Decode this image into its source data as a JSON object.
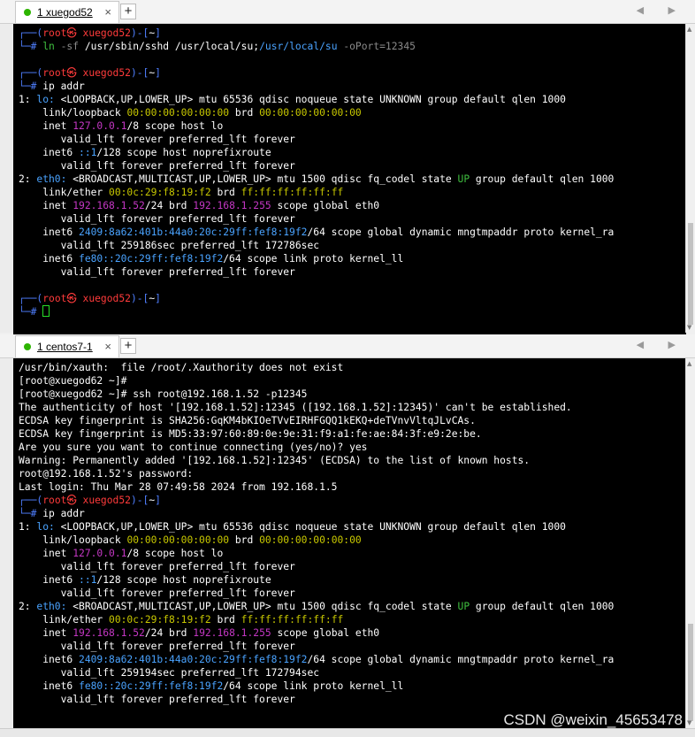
{
  "top": {
    "tab_label": "1 xuegod52",
    "close_glyph": "×",
    "plus_glyph": "+",
    "arrows": "◀ ▶",
    "lines": [
      [
        {
          "t": "┌──(",
          "c": "blue"
        },
        {
          "t": "root㉿ xuegod52",
          "c": "red"
        },
        {
          "t": ")-[",
          "c": "blue"
        },
        {
          "t": "~",
          "c": "white"
        },
        {
          "t": "]",
          "c": "blue"
        }
      ],
      [
        {
          "t": "└─# ",
          "c": "blue"
        },
        {
          "t": "ln",
          "c": "green"
        },
        {
          "t": " -sf ",
          "c": "dim"
        },
        {
          "t": "/usr/sbin/sshd /usr/local/su",
          "c": "white"
        },
        {
          "t": ";",
          "c": "white"
        },
        {
          "t": "/usr/local/su",
          "c": "cyan"
        },
        {
          "t": " -oPort=12345",
          "c": "dim"
        }
      ],
      [],
      [
        {
          "t": "┌──(",
          "c": "blue"
        },
        {
          "t": "root㉿ xuegod52",
          "c": "red"
        },
        {
          "t": ")-[",
          "c": "blue"
        },
        {
          "t": "~",
          "c": "white"
        },
        {
          "t": "]",
          "c": "blue"
        }
      ],
      [
        {
          "t": "└─# ",
          "c": "blue"
        },
        {
          "t": "ip addr",
          "c": "white"
        }
      ],
      [
        {
          "t": "1: ",
          "c": "white"
        },
        {
          "t": "lo:",
          "c": "cyan"
        },
        {
          "t": " <LOOPBACK,UP,LOWER_UP> mtu 65536 qdisc noqueue state UNKNOWN group default qlen 1000",
          "c": "white"
        }
      ],
      [
        {
          "t": "    link/loopback ",
          "c": "white"
        },
        {
          "t": "00:00:00:00:00:00",
          "c": "yellow"
        },
        {
          "t": " brd ",
          "c": "white"
        },
        {
          "t": "00:00:00:00:00:00",
          "c": "yellow"
        }
      ],
      [
        {
          "t": "    inet ",
          "c": "white"
        },
        {
          "t": "127.0.0.1",
          "c": "magenta"
        },
        {
          "t": "/8 scope host lo",
          "c": "white"
        }
      ],
      [
        {
          "t": "       valid_lft forever preferred_lft forever",
          "c": "white"
        }
      ],
      [
        {
          "t": "    inet6 ",
          "c": "white"
        },
        {
          "t": "::1",
          "c": "cyan"
        },
        {
          "t": "/128 scope host noprefixroute",
          "c": "white"
        }
      ],
      [
        {
          "t": "       valid_lft forever preferred_lft forever",
          "c": "white"
        }
      ],
      [
        {
          "t": "2: ",
          "c": "white"
        },
        {
          "t": "eth0:",
          "c": "cyan"
        },
        {
          "t": " <BROADCAST,MULTICAST,UP,LOWER_UP> mtu 1500 qdisc fq_codel state ",
          "c": "white"
        },
        {
          "t": "UP",
          "c": "green"
        },
        {
          "t": " group default qlen 1000",
          "c": "white"
        }
      ],
      [
        {
          "t": "    link/ether ",
          "c": "white"
        },
        {
          "t": "00:0c:29:f8:19:f2",
          "c": "yellow"
        },
        {
          "t": " brd ",
          "c": "white"
        },
        {
          "t": "ff:ff:ff:ff:ff:ff",
          "c": "yellow"
        }
      ],
      [
        {
          "t": "    inet ",
          "c": "white"
        },
        {
          "t": "192.168.1.52",
          "c": "magenta"
        },
        {
          "t": "/24 brd ",
          "c": "white"
        },
        {
          "t": "192.168.1.255",
          "c": "magenta"
        },
        {
          "t": " scope global eth0",
          "c": "white"
        }
      ],
      [
        {
          "t": "       valid_lft forever preferred_lft forever",
          "c": "white"
        }
      ],
      [
        {
          "t": "    inet6 ",
          "c": "white"
        },
        {
          "t": "2409:8a62:401b:44a0:20c:29ff:fef8:19f2",
          "c": "cyan"
        },
        {
          "t": "/64 scope global dynamic mngtmpaddr proto kernel_ra",
          "c": "white"
        }
      ],
      [
        {
          "t": "       valid_lft 259186sec preferred_lft 172786sec",
          "c": "white"
        }
      ],
      [
        {
          "t": "    inet6 ",
          "c": "white"
        },
        {
          "t": "fe80::20c:29ff:fef8:19f2",
          "c": "cyan"
        },
        {
          "t": "/64 scope link proto kernel_ll",
          "c": "white"
        }
      ],
      [
        {
          "t": "       valid_lft forever preferred_lft forever",
          "c": "white"
        }
      ],
      [],
      [
        {
          "t": "┌──(",
          "c": "blue"
        },
        {
          "t": "root㉿ xuegod52",
          "c": "red"
        },
        {
          "t": ")-[",
          "c": "blue"
        },
        {
          "t": "~",
          "c": "white"
        },
        {
          "t": "]",
          "c": "blue"
        }
      ],
      [
        {
          "t": "└─# ",
          "c": "blue"
        },
        {
          "t": "",
          "c": "cursor"
        }
      ]
    ]
  },
  "bottom": {
    "tab_label": "1 centos7-1",
    "close_glyph": "×",
    "plus_glyph": "+",
    "arrows": "◀ ▶",
    "lines": [
      [
        {
          "t": "/usr/bin/xauth:  file /root/.Xauthority does not exist",
          "c": "white"
        }
      ],
      [
        {
          "t": "[root@xuegod62 ~]#",
          "c": "white"
        }
      ],
      [
        {
          "t": "[root@xuegod62 ~]# ssh root@192.168.1.52 -p12345",
          "c": "white"
        }
      ],
      [
        {
          "t": "The authenticity of host '[192.168.1.52]:12345 ([192.168.1.52]:12345)' can't be established.",
          "c": "white"
        }
      ],
      [
        {
          "t": "ECDSA key fingerprint is SHA256:GqKM4bKIOeTVvEIRHFGQQ1kEKQ+deTVnvVltqJLvCAs.",
          "c": "white"
        }
      ],
      [
        {
          "t": "ECDSA key fingerprint is MD5:33:97:60:89:0e:9e:31:f9:a1:fe:ae:84:3f:e9:2e:be.",
          "c": "white"
        }
      ],
      [
        {
          "t": "Are you sure you want to continue connecting (yes/no)? yes",
          "c": "white"
        }
      ],
      [
        {
          "t": "Warning: Permanently added '[192.168.1.52]:12345' (ECDSA) to the list of known hosts.",
          "c": "white"
        }
      ],
      [
        {
          "t": "root@192.168.1.52's password:",
          "c": "white"
        }
      ],
      [
        {
          "t": "Last login: Thu Mar 28 07:49:58 2024 from 192.168.1.5",
          "c": "white"
        }
      ],
      [
        {
          "t": "┌──(",
          "c": "blue"
        },
        {
          "t": "root㉿ xuegod52",
          "c": "red"
        },
        {
          "t": ")-[",
          "c": "blue"
        },
        {
          "t": "~",
          "c": "white"
        },
        {
          "t": "]",
          "c": "blue"
        }
      ],
      [
        {
          "t": "└─# ",
          "c": "blue"
        },
        {
          "t": "ip addr",
          "c": "white"
        }
      ],
      [
        {
          "t": "1: ",
          "c": "white"
        },
        {
          "t": "lo:",
          "c": "cyan"
        },
        {
          "t": " <LOOPBACK,UP,LOWER_UP> mtu 65536 qdisc noqueue state UNKNOWN group default qlen 1000",
          "c": "white"
        }
      ],
      [
        {
          "t": "    link/loopback ",
          "c": "white"
        },
        {
          "t": "00:00:00:00:00:00",
          "c": "yellow"
        },
        {
          "t": " brd ",
          "c": "white"
        },
        {
          "t": "00:00:00:00:00:00",
          "c": "yellow"
        }
      ],
      [
        {
          "t": "    inet ",
          "c": "white"
        },
        {
          "t": "127.0.0.1",
          "c": "magenta"
        },
        {
          "t": "/8 scope host lo",
          "c": "white"
        }
      ],
      [
        {
          "t": "       valid_lft forever preferred_lft forever",
          "c": "white"
        }
      ],
      [
        {
          "t": "    inet6 ",
          "c": "white"
        },
        {
          "t": "::1",
          "c": "cyan"
        },
        {
          "t": "/128 scope host noprefixroute",
          "c": "white"
        }
      ],
      [
        {
          "t": "       valid_lft forever preferred_lft forever",
          "c": "white"
        }
      ],
      [
        {
          "t": "2: ",
          "c": "white"
        },
        {
          "t": "eth0:",
          "c": "cyan"
        },
        {
          "t": " <BROADCAST,MULTICAST,UP,LOWER_UP> mtu 1500 qdisc fq_codel state ",
          "c": "white"
        },
        {
          "t": "UP",
          "c": "green"
        },
        {
          "t": " group default qlen 1000",
          "c": "white"
        }
      ],
      [
        {
          "t": "    link/ether ",
          "c": "white"
        },
        {
          "t": "00:0c:29:f8:19:f2",
          "c": "yellow"
        },
        {
          "t": " brd ",
          "c": "white"
        },
        {
          "t": "ff:ff:ff:ff:ff:ff",
          "c": "yellow"
        }
      ],
      [
        {
          "t": "    inet ",
          "c": "white"
        },
        {
          "t": "192.168.1.52",
          "c": "magenta"
        },
        {
          "t": "/24 brd ",
          "c": "white"
        },
        {
          "t": "192.168.1.255",
          "c": "magenta"
        },
        {
          "t": " scope global eth0",
          "c": "white"
        }
      ],
      [
        {
          "t": "       valid_lft forever preferred_lft forever",
          "c": "white"
        }
      ],
      [
        {
          "t": "    inet6 ",
          "c": "white"
        },
        {
          "t": "2409:8a62:401b:44a0:20c:29ff:fef8:19f2",
          "c": "cyan"
        },
        {
          "t": "/64 scope global dynamic mngtmpaddr proto kernel_ra",
          "c": "white"
        }
      ],
      [
        {
          "t": "       valid_lft 259194sec preferred_lft 172794sec",
          "c": "white"
        }
      ],
      [
        {
          "t": "    inet6 ",
          "c": "white"
        },
        {
          "t": "fe80::20c:29ff:fef8:19f2",
          "c": "cyan"
        },
        {
          "t": "/64 scope link proto kernel_ll",
          "c": "white"
        }
      ],
      [
        {
          "t": "       valid_lft forever preferred_lft forever",
          "c": "white"
        }
      ]
    ]
  },
  "watermark": "CSDN @weixin_45653478",
  "colors": {
    "terminal_bg": "#000000",
    "prompt_blue": "#4f7fff",
    "prompt_red": "#ff3b3b",
    "status_green": "#3fbf3f",
    "ip_magenta": "#c437c4",
    "mac_yellow": "#c8c800",
    "iface_cyan": "#4aa3ff"
  }
}
